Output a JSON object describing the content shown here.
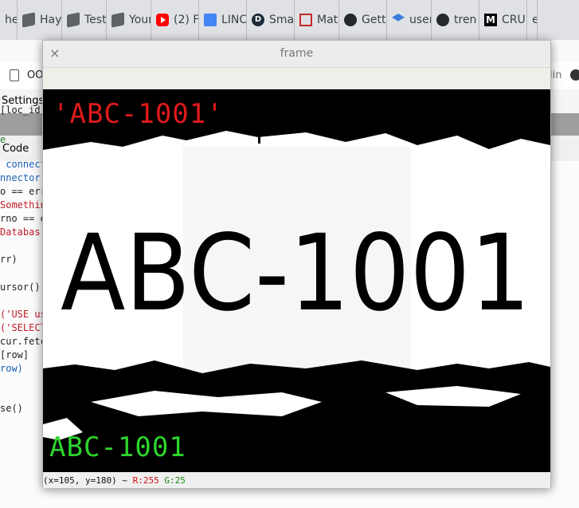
{
  "browser": {
    "tabs": [
      {
        "label": "he",
        "icon": "none"
      },
      {
        "label": "Hay",
        "icon": "cube-icon"
      },
      {
        "label": "Test",
        "icon": "cube-icon"
      },
      {
        "label": "Your",
        "icon": "cube-icon"
      },
      {
        "label": "(2) F",
        "icon": "youtube-icon"
      },
      {
        "label": "LINC",
        "icon": "docs-icon"
      },
      {
        "label": "Sma",
        "icon": "d-logo-icon"
      },
      {
        "label": "Mat",
        "icon": "matrix-icon"
      },
      {
        "label": "Gett",
        "icon": "github-icon"
      },
      {
        "label": "user",
        "icon": "stack-icon"
      },
      {
        "label": "tren",
        "icon": "github-icon"
      },
      {
        "label": "CRU",
        "icon": "medium-icon"
      },
      {
        "label": "e",
        "icon": "none"
      }
    ],
    "bookmark_label": "OO",
    "bookmark_right": "lin",
    "settings_label": "Settings",
    "code_tab_label": "Code"
  },
  "code_lines": [
    {
      "text": "[loc_id",
      "color": "#222222"
    },
    {
      "text": "e",
      "color": "#2e7d32"
    },
    {
      "text": " connect",
      "color": "#1a5fb4"
    },
    {
      "text": "nnector",
      "color": "#1a5fb4"
    },
    {
      "text": "o == err",
      "color": "#222222"
    },
    {
      "text": "Somethin",
      "color": "#c01c28"
    },
    {
      "text": "rno == e",
      "color": "#222222"
    },
    {
      "text": "Databas",
      "color": "#c01c28"
    },
    {
      "text": "rr)",
      "color": "#222222"
    },
    {
      "text": "ursor()",
      "color": "#222222"
    },
    {
      "text": "('USE us",
      "color": "#c01c28"
    },
    {
      "text": "('SELECT",
      "color": "#c01c28"
    },
    {
      "text": "cur.fetc",
      "color": "#222222"
    },
    {
      "text": "[row]",
      "color": "#222222"
    },
    {
      "text": "row)",
      "color": "#1a5fb4"
    },
    {
      "text": "se()",
      "color": "#222222"
    }
  ],
  "frame_window": {
    "title": "frame",
    "close_symbol": "×",
    "image_text": "ABC-1001",
    "overlay_red_text": "'ABC-1001'",
    "overlay_green_text": "ABC-1001",
    "status": {
      "coords": "(x=105, y=180) ~",
      "r_value": "R:255",
      "g_value": "G:25"
    }
  }
}
